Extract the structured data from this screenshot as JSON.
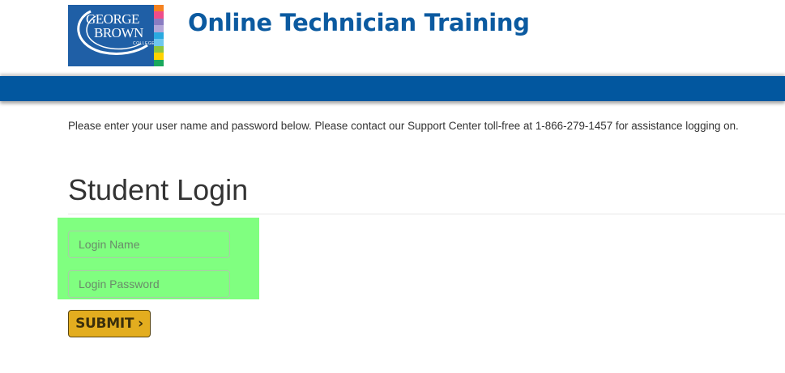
{
  "header": {
    "logo": {
      "line1": "GEORGE",
      "line2": "BROWN",
      "sub": "COLLEGE",
      "background": "#1f5fa6",
      "stripes": [
        "#f58220",
        "#ee4d8a",
        "#8a7cc2",
        "#b3a6d8",
        "#2aa9e0",
        "#6ec7ee",
        "#8dc63f",
        "#ffd200",
        "#1aa85c"
      ]
    },
    "title": "Online Technician Training",
    "title_color": "#0b5aa0"
  },
  "nav_bar": {
    "color": "#02579f"
  },
  "notice": "Please enter your user name and password below. Please contact our Support Center toll-free at 1-866-279-1457 for assistance logging on.",
  "login": {
    "heading": "Student Login",
    "username_placeholder": "Login Name",
    "password_placeholder": "Login Password",
    "submit_label": "SUBMIT",
    "submit_icon": "chevron-right-icon",
    "highlight_color": "#80ff80",
    "submit_color": "#e3ad1f"
  }
}
